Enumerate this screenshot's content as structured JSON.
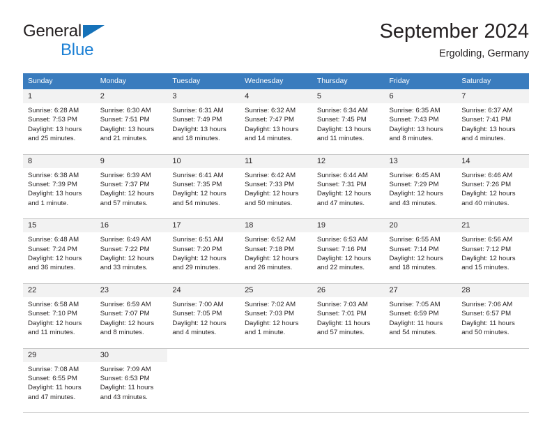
{
  "brand": {
    "name_part1": "General",
    "name_part2": "Blue",
    "triangle_color": "#1672b9",
    "blue_text_color": "#1a7fd4"
  },
  "header": {
    "title": "September 2024",
    "subtitle": "Ergolding, Germany"
  },
  "theme": {
    "header_row_bg": "#3a7cbe",
    "header_row_text": "#ffffff",
    "daynum_bg": "#f2f2f2",
    "cell_bg": "#ffffff",
    "text": "#231f20",
    "separator": "#c8c8c8"
  },
  "calendar": {
    "weekday_headers": [
      "Sunday",
      "Monday",
      "Tuesday",
      "Wednesday",
      "Thursday",
      "Friday",
      "Saturday"
    ],
    "weeks": [
      [
        {
          "day": "1",
          "sunrise": "Sunrise: 6:28 AM",
          "sunset": "Sunset: 7:53 PM",
          "daylight": "Daylight: 13 hours and 25 minutes."
        },
        {
          "day": "2",
          "sunrise": "Sunrise: 6:30 AM",
          "sunset": "Sunset: 7:51 PM",
          "daylight": "Daylight: 13 hours and 21 minutes."
        },
        {
          "day": "3",
          "sunrise": "Sunrise: 6:31 AM",
          "sunset": "Sunset: 7:49 PM",
          "daylight": "Daylight: 13 hours and 18 minutes."
        },
        {
          "day": "4",
          "sunrise": "Sunrise: 6:32 AM",
          "sunset": "Sunset: 7:47 PM",
          "daylight": "Daylight: 13 hours and 14 minutes."
        },
        {
          "day": "5",
          "sunrise": "Sunrise: 6:34 AM",
          "sunset": "Sunset: 7:45 PM",
          "daylight": "Daylight: 13 hours and 11 minutes."
        },
        {
          "day": "6",
          "sunrise": "Sunrise: 6:35 AM",
          "sunset": "Sunset: 7:43 PM",
          "daylight": "Daylight: 13 hours and 8 minutes."
        },
        {
          "day": "7",
          "sunrise": "Sunrise: 6:37 AM",
          "sunset": "Sunset: 7:41 PM",
          "daylight": "Daylight: 13 hours and 4 minutes."
        }
      ],
      [
        {
          "day": "8",
          "sunrise": "Sunrise: 6:38 AM",
          "sunset": "Sunset: 7:39 PM",
          "daylight": "Daylight: 13 hours and 1 minute."
        },
        {
          "day": "9",
          "sunrise": "Sunrise: 6:39 AM",
          "sunset": "Sunset: 7:37 PM",
          "daylight": "Daylight: 12 hours and 57 minutes."
        },
        {
          "day": "10",
          "sunrise": "Sunrise: 6:41 AM",
          "sunset": "Sunset: 7:35 PM",
          "daylight": "Daylight: 12 hours and 54 minutes."
        },
        {
          "day": "11",
          "sunrise": "Sunrise: 6:42 AM",
          "sunset": "Sunset: 7:33 PM",
          "daylight": "Daylight: 12 hours and 50 minutes."
        },
        {
          "day": "12",
          "sunrise": "Sunrise: 6:44 AM",
          "sunset": "Sunset: 7:31 PM",
          "daylight": "Daylight: 12 hours and 47 minutes."
        },
        {
          "day": "13",
          "sunrise": "Sunrise: 6:45 AM",
          "sunset": "Sunset: 7:29 PM",
          "daylight": "Daylight: 12 hours and 43 minutes."
        },
        {
          "day": "14",
          "sunrise": "Sunrise: 6:46 AM",
          "sunset": "Sunset: 7:26 PM",
          "daylight": "Daylight: 12 hours and 40 minutes."
        }
      ],
      [
        {
          "day": "15",
          "sunrise": "Sunrise: 6:48 AM",
          "sunset": "Sunset: 7:24 PM",
          "daylight": "Daylight: 12 hours and 36 minutes."
        },
        {
          "day": "16",
          "sunrise": "Sunrise: 6:49 AM",
          "sunset": "Sunset: 7:22 PM",
          "daylight": "Daylight: 12 hours and 33 minutes."
        },
        {
          "day": "17",
          "sunrise": "Sunrise: 6:51 AM",
          "sunset": "Sunset: 7:20 PM",
          "daylight": "Daylight: 12 hours and 29 minutes."
        },
        {
          "day": "18",
          "sunrise": "Sunrise: 6:52 AM",
          "sunset": "Sunset: 7:18 PM",
          "daylight": "Daylight: 12 hours and 26 minutes."
        },
        {
          "day": "19",
          "sunrise": "Sunrise: 6:53 AM",
          "sunset": "Sunset: 7:16 PM",
          "daylight": "Daylight: 12 hours and 22 minutes."
        },
        {
          "day": "20",
          "sunrise": "Sunrise: 6:55 AM",
          "sunset": "Sunset: 7:14 PM",
          "daylight": "Daylight: 12 hours and 18 minutes."
        },
        {
          "day": "21",
          "sunrise": "Sunrise: 6:56 AM",
          "sunset": "Sunset: 7:12 PM",
          "daylight": "Daylight: 12 hours and 15 minutes."
        }
      ],
      [
        {
          "day": "22",
          "sunrise": "Sunrise: 6:58 AM",
          "sunset": "Sunset: 7:10 PM",
          "daylight": "Daylight: 12 hours and 11 minutes."
        },
        {
          "day": "23",
          "sunrise": "Sunrise: 6:59 AM",
          "sunset": "Sunset: 7:07 PM",
          "daylight": "Daylight: 12 hours and 8 minutes."
        },
        {
          "day": "24",
          "sunrise": "Sunrise: 7:00 AM",
          "sunset": "Sunset: 7:05 PM",
          "daylight": "Daylight: 12 hours and 4 minutes."
        },
        {
          "day": "25",
          "sunrise": "Sunrise: 7:02 AM",
          "sunset": "Sunset: 7:03 PM",
          "daylight": "Daylight: 12 hours and 1 minute."
        },
        {
          "day": "26",
          "sunrise": "Sunrise: 7:03 AM",
          "sunset": "Sunset: 7:01 PM",
          "daylight": "Daylight: 11 hours and 57 minutes."
        },
        {
          "day": "27",
          "sunrise": "Sunrise: 7:05 AM",
          "sunset": "Sunset: 6:59 PM",
          "daylight": "Daylight: 11 hours and 54 minutes."
        },
        {
          "day": "28",
          "sunrise": "Sunrise: 7:06 AM",
          "sunset": "Sunset: 6:57 PM",
          "daylight": "Daylight: 11 hours and 50 minutes."
        }
      ],
      [
        {
          "day": "29",
          "sunrise": "Sunrise: 7:08 AM",
          "sunset": "Sunset: 6:55 PM",
          "daylight": "Daylight: 11 hours and 47 minutes."
        },
        {
          "day": "30",
          "sunrise": "Sunrise: 7:09 AM",
          "sunset": "Sunset: 6:53 PM",
          "daylight": "Daylight: 11 hours and 43 minutes."
        },
        {
          "day": "",
          "sunrise": "",
          "sunset": "",
          "daylight": ""
        },
        {
          "day": "",
          "sunrise": "",
          "sunset": "",
          "daylight": ""
        },
        {
          "day": "",
          "sunrise": "",
          "sunset": "",
          "daylight": ""
        },
        {
          "day": "",
          "sunrise": "",
          "sunset": "",
          "daylight": ""
        },
        {
          "day": "",
          "sunrise": "",
          "sunset": "",
          "daylight": ""
        }
      ]
    ]
  }
}
